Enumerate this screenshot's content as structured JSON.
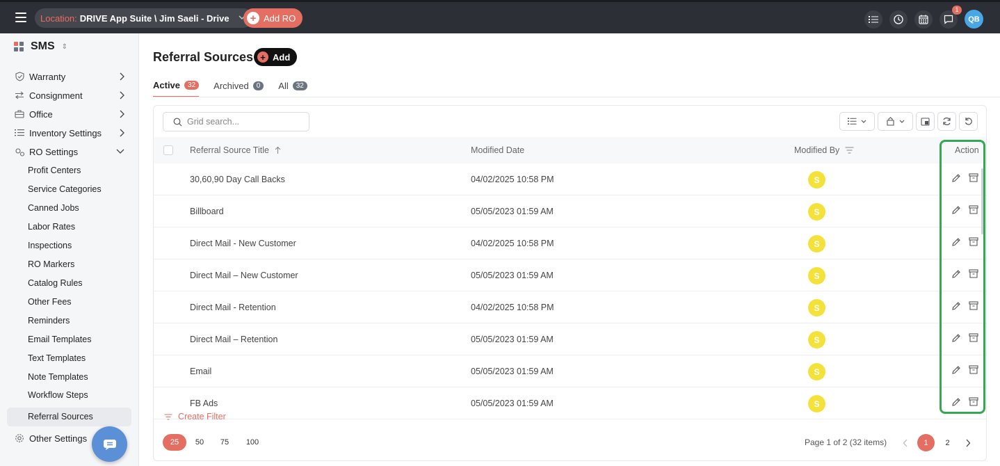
{
  "topbar": {
    "location_label": "Location:",
    "location_value": "DRIVE App Suite \\ Jim Saeli - Drive",
    "add_ro_label": "Add RO",
    "notification_count": "1",
    "user_initials": "QB"
  },
  "sidebar": {
    "app_name": "SMS",
    "items": [
      {
        "label": "Warranty"
      },
      {
        "label": "Consignment"
      },
      {
        "label": "Office"
      },
      {
        "label": "Inventory Settings"
      },
      {
        "label": "RO Settings"
      }
    ],
    "ro_settings_children": [
      "Profit Centers",
      "Service Categories",
      "Canned Jobs",
      "Labor Rates",
      "Inspections",
      "RO Markers",
      "Catalog Rules",
      "Other Fees",
      "Reminders",
      "Email Templates",
      "Text Templates",
      "Note Templates",
      "Workflow Steps",
      "Referral Sources"
    ],
    "other_settings": "Other Settings"
  },
  "page": {
    "title": "Referral Sources",
    "add_label": "Add",
    "tabs": [
      {
        "label": "Active",
        "count": "32"
      },
      {
        "label": "Archived",
        "count": "0"
      },
      {
        "label": "All",
        "count": "32"
      }
    ]
  },
  "grid": {
    "search_placeholder": "Grid search...",
    "columns": {
      "title": "Referral Source Title",
      "modified_date": "Modified Date",
      "modified_by": "Modified By",
      "action": "Action"
    },
    "rows": [
      {
        "title": "30,60,90 Day Call Backs",
        "date": "04/02/2025 10:58 PM",
        "by": "S"
      },
      {
        "title": "Billboard",
        "date": "05/05/2023 01:59 AM",
        "by": "S"
      },
      {
        "title": "Direct Mail - New Customer",
        "date": "04/02/2025 10:58 PM",
        "by": "S"
      },
      {
        "title": "Direct Mail – New Customer",
        "date": "05/05/2023 01:59 AM",
        "by": "S"
      },
      {
        "title": "Direct Mail - Retention",
        "date": "04/02/2025 10:58 PM",
        "by": "S"
      },
      {
        "title": "Direct Mail – Retention",
        "date": "05/05/2023 01:59 AM",
        "by": "S"
      },
      {
        "title": "Email",
        "date": "05/05/2023 01:59 AM",
        "by": "S"
      },
      {
        "title": "FB Ads",
        "date": "05/05/2023 01:59 AM",
        "by": "S"
      }
    ],
    "create_filter": "Create Filter",
    "page_sizes": [
      "25",
      "50",
      "75",
      "100"
    ],
    "page_info": "Page 1 of 2 (32 items)",
    "pages": [
      "1",
      "2"
    ]
  },
  "colors": {
    "accent": "#e56e63",
    "topbar": "#2c2f35",
    "highlight": "#34a853",
    "avatar_yellow": "#f4e23a"
  }
}
